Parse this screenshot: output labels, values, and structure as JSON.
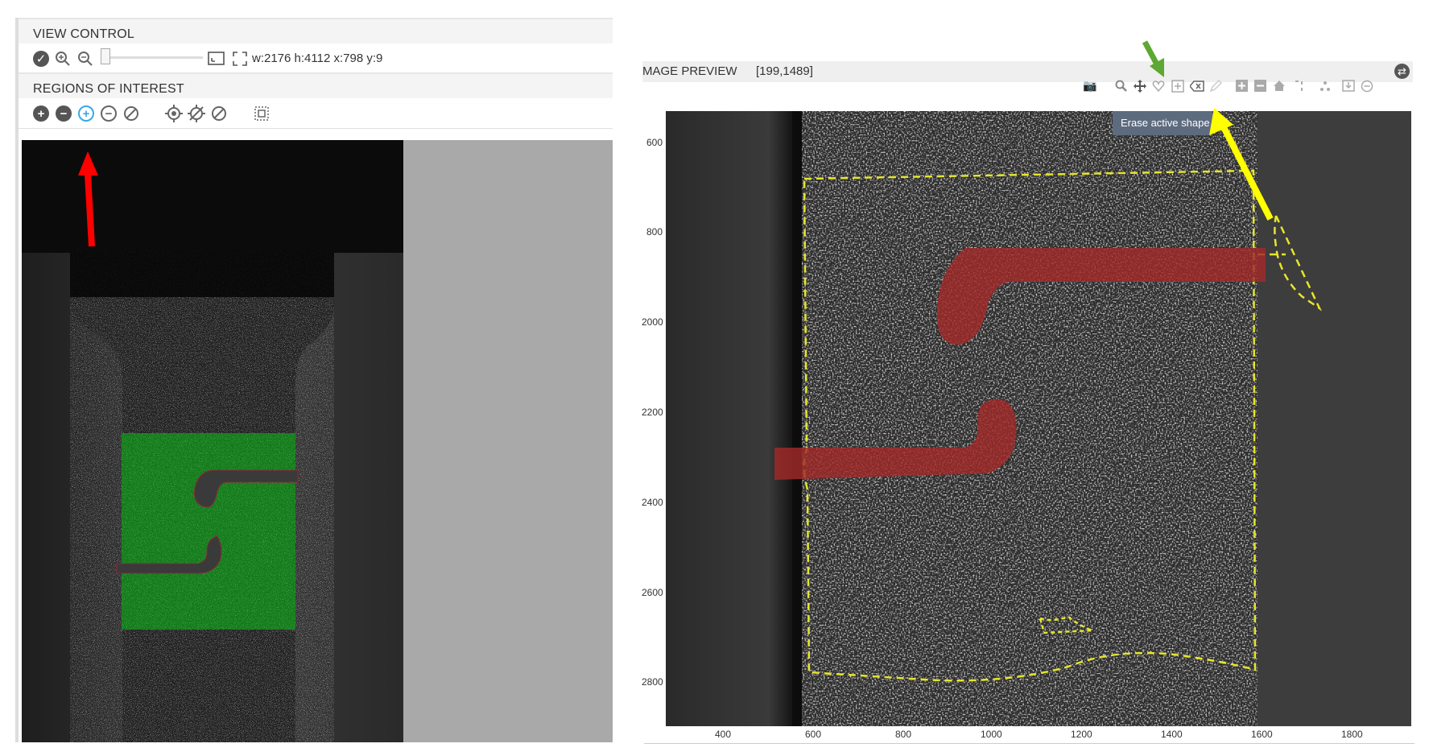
{
  "view_control": {
    "title": "VIEW CONTROL",
    "dimensions_readout": "w:2176 h:4112 x:798 y:9"
  },
  "regions_of_interest": {
    "title": "REGIONS OF INTEREST"
  },
  "image_preview": {
    "title": "MAGE PREVIEW",
    "coords": "[199,1489]",
    "tooltip": "Erase active shape",
    "x_ticks": [
      "400",
      "600",
      "800",
      "1000",
      "1200",
      "1400",
      "1600",
      "1800"
    ],
    "y_ticks": [
      "600",
      "800",
      "2000",
      "2200",
      "2400",
      "2600",
      "2800"
    ]
  },
  "icons": {
    "view_control": [
      "checkmark-icon",
      "zoom-in-icon",
      "zoom-out-icon",
      "zoom-slider",
      "fit-window-icon",
      "fullscreen-icon"
    ],
    "roi": [
      "add-icon",
      "remove-icon",
      "add-shape-icon",
      "remove-shape-icon",
      "clear-icon",
      "target-icon",
      "target-cross-icon",
      "clear-target-icon",
      "select-region-icon"
    ],
    "modebar": [
      "camera-icon",
      "zoom-icon",
      "pan-icon",
      "lasso-icon",
      "box-select-icon",
      "erase-icon",
      "draw-icon",
      "zoom-in-plus-icon",
      "zoom-out-minus-icon",
      "home-icon",
      "spike-icon",
      "compare-icon",
      "download-icon",
      "minus-circle-icon"
    ]
  },
  "annotations": {
    "red_arrow": "#ff0000",
    "green_arrow": "#5ca832",
    "yellow_arrow": "#ffff00"
  }
}
